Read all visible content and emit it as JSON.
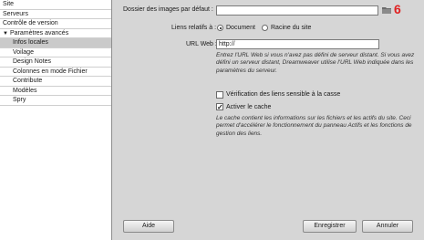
{
  "sidebar": {
    "items": [
      {
        "label": "Site"
      },
      {
        "label": "Serveurs"
      },
      {
        "label": "Contrôle de version"
      },
      {
        "label": "Paramètres avancés",
        "expanded": true
      },
      {
        "label": "Infos locales",
        "selected": true
      },
      {
        "label": "Voilage"
      },
      {
        "label": "Design Notes"
      },
      {
        "label": "Colonnes en mode Fichier"
      },
      {
        "label": "Contribute"
      },
      {
        "label": "Modèles"
      },
      {
        "label": "Spry"
      }
    ]
  },
  "form": {
    "default_images_label": "Dossier des images par défaut :",
    "default_images_value": "",
    "annotation_number": "6",
    "relative_links_label": "Liens relatifs à :",
    "relative_document_label": "Document",
    "relative_site_root_label": "Racine du site",
    "relative_selected": "Document",
    "web_url_label": "URL Web :",
    "web_url_value": "http://",
    "web_url_help": "Entrez l'URL Web si vous n'avez pas défini de serveur distant. Si vous avez défini un serveur distant, Dreamweaver utilise l'URL Web indiquée dans les paramètres du serveur.",
    "case_sensitive_label": "Vérification des liens sensible à la casse",
    "case_sensitive_checked": false,
    "enable_cache_label": "Activer le cache",
    "enable_cache_checked": true,
    "cache_help": "Le cache contient les informations sur les fichiers et les actifs du site. Ceci permet d'accélérer le fonctionnement du panneau Actifs et les fonctions de gestion des liens."
  },
  "buttons": {
    "help": "Aide",
    "save": "Enregistrer",
    "cancel": "Annuler"
  },
  "colors": {
    "annotation": "#e02020",
    "selected_row": "#cacaca"
  },
  "icons": {
    "folder": "folder-icon",
    "expand": "triangle-down-icon"
  }
}
